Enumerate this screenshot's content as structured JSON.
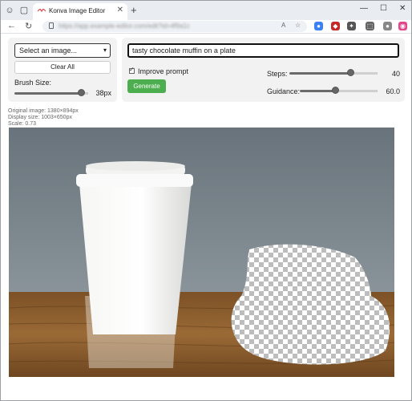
{
  "browser": {
    "tab_title": "Konva Image Editor",
    "new_tab": "+",
    "url": "https://app.example-editor.com/edit?id=4f9a1c",
    "window_controls": [
      "minimize-icon",
      "maximize-icon",
      "close-icon"
    ],
    "extensions": [
      {
        "name": "translate-icon",
        "color": "#3b82f6",
        "glyph": "●"
      },
      {
        "name": "shield-icon",
        "color": "#c62828",
        "glyph": "◆"
      },
      {
        "name": "puzzle-icon",
        "color": "#555555",
        "glyph": "✦"
      },
      {
        "name": "collections-icon",
        "color": "#666666",
        "glyph": "⬚"
      },
      {
        "name": "copilot-icon",
        "color": "#e0488b",
        "glyph": "◉"
      }
    ]
  },
  "left_panel": {
    "select_value": "Select an image...",
    "clear_label": "Clear All",
    "brush_label": "Brush Size:",
    "brush_value": "38px",
    "brush_fraction": 0.95
  },
  "right_panel": {
    "prompt_value": "tasty chocolate muffin on a plate",
    "improve_label": "Improve prompt",
    "improve_checked": true,
    "generate_label": "Generate",
    "steps_label": "Steps:",
    "steps_value": "40",
    "steps_fraction": 0.71,
    "guidance_label": "Guidance:",
    "guidance_value": "60.0",
    "guidance_fraction": 0.45
  },
  "info": {
    "original": "Original image: 1380×894px",
    "display": "Display size: 1003×650px",
    "scale": "Scale: 0.73"
  },
  "colors": {
    "accent_green": "#4cae4f",
    "background_wall": "#6e7a82",
    "table_wood": "#8a5a2b"
  }
}
